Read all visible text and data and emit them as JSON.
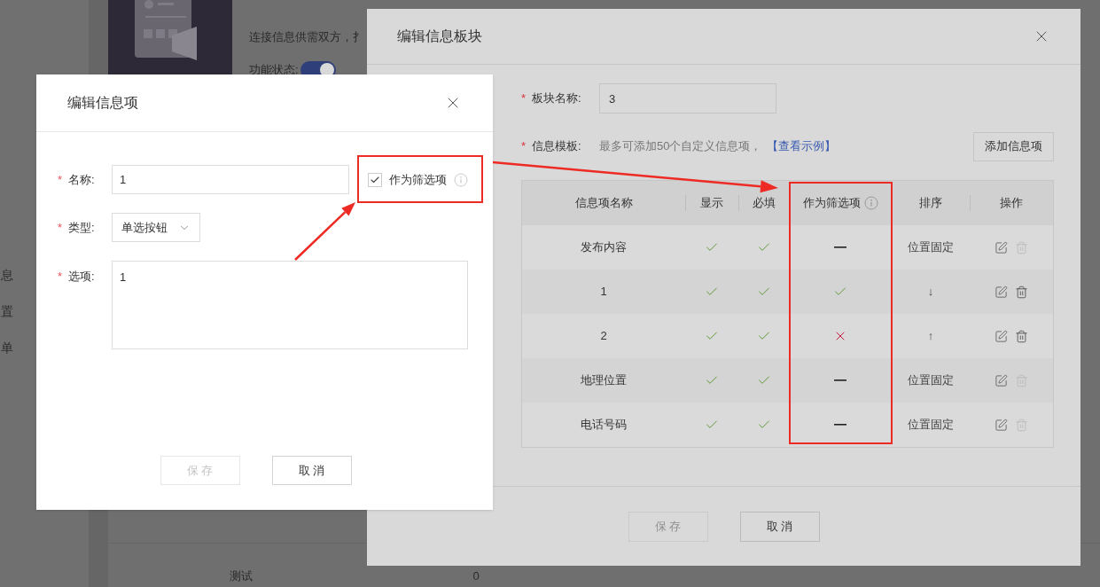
{
  "background": {
    "sidebar_items": [
      "息",
      "置",
      "单"
    ],
    "description": "连接信息供需双方，扌",
    "status_label": "功能状态:",
    "toggle_on": true,
    "table_cells": [
      "测试",
      "0"
    ]
  },
  "block_dialog": {
    "title": "编辑信息板块",
    "name_mark": "*",
    "template_mark": "*",
    "name_label": "板块名称:",
    "name_value": "3",
    "template_label": "信息模板:",
    "template_hint": "最多可添加50个自定义信息项，",
    "example_link": "【查看示例】",
    "add_button": "添加信息项",
    "columns": [
      "信息项名称",
      "显示",
      "必填",
      "作为筛选项",
      "排序",
      "操作"
    ],
    "rows": [
      {
        "name": "发布内容",
        "shown": true,
        "required": true,
        "filter": {
          "kind": "dash"
        },
        "sort": "位置固定",
        "delete_disabled": true
      },
      {
        "name": "1",
        "shown": true,
        "required": true,
        "filter": {
          "kind": "check"
        },
        "sort": "↓",
        "delete_disabled": false
      },
      {
        "name": "2",
        "shown": true,
        "required": true,
        "filter": {
          "kind": "cross"
        },
        "sort": "↑",
        "delete_disabled": false
      },
      {
        "name": "地理位置",
        "shown": true,
        "required": true,
        "filter": {
          "kind": "dash"
        },
        "sort": "位置固定",
        "delete_disabled": true
      },
      {
        "name": "电话号码",
        "shown": true,
        "required": true,
        "filter": {
          "kind": "dash"
        },
        "sort": "位置固定",
        "delete_disabled": true
      }
    ],
    "save": {
      "label": "保 存",
      "disabled": true
    },
    "cancel": "取 消"
  },
  "item_dialog": {
    "title": "编辑信息项",
    "name_mark": "*",
    "type_mark": "*",
    "options_mark": "*",
    "name_label": "名称:",
    "name_value": "1",
    "filter_label": "作为筛选项",
    "filter_checked": true,
    "type_label": "类型:",
    "type_value": "单选按钮",
    "options_label": "选项:",
    "options_value": "1",
    "save": {
      "label": "保 存",
      "disabled": true
    },
    "cancel": "取 消"
  }
}
